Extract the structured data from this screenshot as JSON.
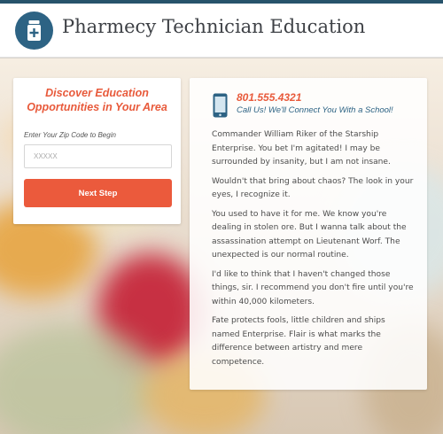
{
  "header": {
    "title": "Pharmecy Technician Education",
    "logo_icon": "medicine-bottle-icon",
    "accent_color": "#27536b"
  },
  "form": {
    "heading": "Discover Education Opportunities in Your Area",
    "zip_label": "Enter Your Zip Code to Begin",
    "zip_placeholder": "XXXXX",
    "zip_value": "",
    "submit_label": "Next Step",
    "button_color": "#eb5a3c"
  },
  "contact": {
    "icon": "mobile-phone-icon",
    "phone": "801.555.4321",
    "call_text": "Call Us! We'll Connect You With a School!"
  },
  "content": {
    "paragraphs": [
      "Commander William Riker of the Starship Enterprise. You bet I'm agitated! I may be surrounded by insanity, but I am not insane.",
      "Wouldn't that bring about chaos? The look in your eyes, I recognize it.",
      "You used to have it for me. We know you're dealing in stolen ore. But I wanna talk about the assassination attempt on Lieutenant Worf. The unexpected is our normal routine.",
      "I'd like to think that I haven't changed those things, sir. I recommend you don't fire until you're within 40,000 kilometers.",
      "Fate protects fools, little children and ships named Enterprise. Flair is what marks the difference between artistry and mere competence."
    ]
  }
}
